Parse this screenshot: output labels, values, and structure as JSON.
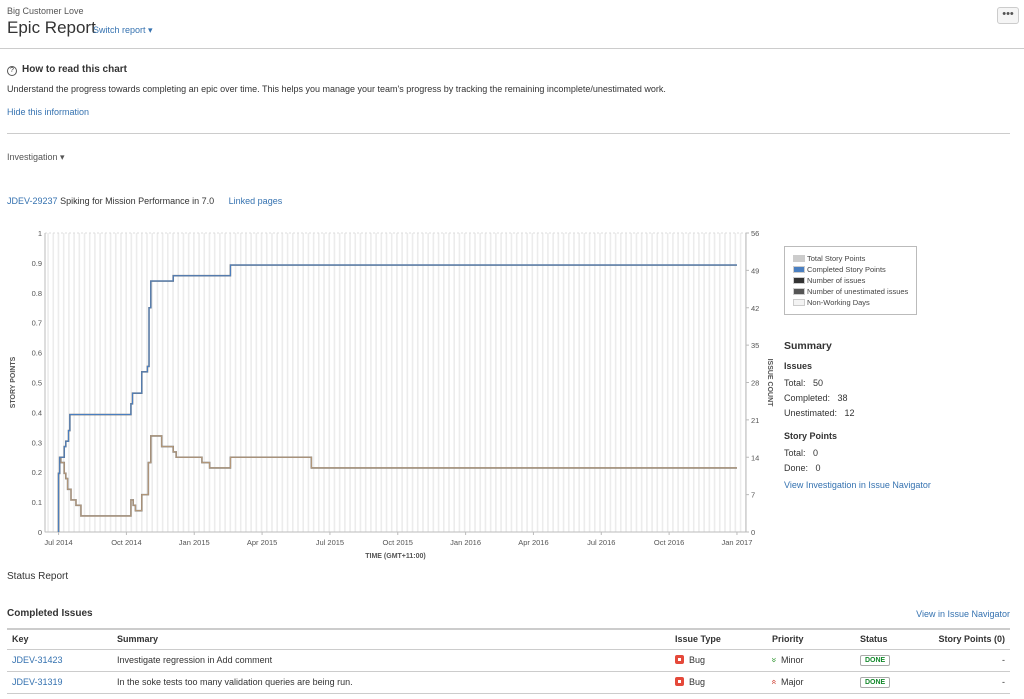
{
  "header": {
    "project": "Big Customer Love",
    "title": "Epic Report",
    "switch_report": "Switch report ▾",
    "more": "•••"
  },
  "howto": {
    "title": "How to read this chart",
    "description": "Understand the progress towards completing an epic over time. This helps you manage your team's progress by tracking the remaining incomplete/unestimated work.",
    "hide": "Hide this information"
  },
  "epic_select": "Investigation ▾",
  "epic": {
    "key": "JDEV-29237",
    "name": "Spiking for Mission Performance in 7.0",
    "linked": "Linked pages"
  },
  "colors": {
    "blue": "#4a7fc1",
    "brown": "#b89a7a",
    "dark": "#555555",
    "link": "#3572b0"
  },
  "chart_data": {
    "type": "line",
    "xlabel": "TIME (GMT+11:00)",
    "ylabel": "STORY POINTS",
    "y2label": "ISSUE COUNT",
    "x_unit": "months since Jul 2014",
    "xlim": [
      -0.6,
      30.4
    ],
    "x_ticks": [
      {
        "m": 0,
        "label": "Jul 2014"
      },
      {
        "m": 3,
        "label": "Oct 2014"
      },
      {
        "m": 6,
        "label": "Jan 2015"
      },
      {
        "m": 9,
        "label": "Apr 2015"
      },
      {
        "m": 12,
        "label": "Jul 2015"
      },
      {
        "m": 15,
        "label": "Oct 2015"
      },
      {
        "m": 18,
        "label": "Jan 2016"
      },
      {
        "m": 21,
        "label": "Apr 2016"
      },
      {
        "m": 24,
        "label": "Jul 2016"
      },
      {
        "m": 27,
        "label": "Oct 2016"
      },
      {
        "m": 30,
        "label": "Jan 2017"
      }
    ],
    "ylim": [
      0,
      1
    ],
    "y_ticks": [
      "0",
      "0.1",
      "0.2",
      "0.3",
      "0.4",
      "0.5",
      "0.6",
      "0.7",
      "0.8",
      "0.9",
      "1"
    ],
    "y2lim": [
      0,
      56
    ],
    "y2_ticks": [
      "0",
      "7",
      "14",
      "21",
      "28",
      "35",
      "42",
      "49",
      "56"
    ],
    "legend": [
      "Total Story Points",
      "Completed Story Points",
      "Number of issues",
      "Number of unestimated issues",
      "Non-Working Days"
    ],
    "series": [
      {
        "name": "Number of issues",
        "color": "#4a7fc1",
        "points": [
          [
            0,
            0
          ],
          [
            0,
            11
          ],
          [
            0.05,
            14
          ],
          [
            0.25,
            16
          ],
          [
            0.32,
            17
          ],
          [
            0.44,
            19
          ],
          [
            0.5,
            22
          ],
          [
            3.2,
            24
          ],
          [
            3.27,
            26
          ],
          [
            3.68,
            30
          ],
          [
            3.93,
            31
          ],
          [
            4.0,
            42
          ],
          [
            4.08,
            47
          ],
          [
            5.07,
            48
          ],
          [
            7.6,
            50
          ],
          [
            30,
            50
          ]
        ]
      },
      {
        "name": "Number of unestimated issues",
        "color": "#b89a7a",
        "points": [
          [
            0,
            0
          ],
          [
            0,
            11
          ],
          [
            0.05,
            14
          ],
          [
            0.1,
            13
          ],
          [
            0.25,
            11
          ],
          [
            0.32,
            10
          ],
          [
            0.4,
            8
          ],
          [
            0.55,
            6
          ],
          [
            0.77,
            5
          ],
          [
            0.99,
            3
          ],
          [
            3.2,
            6
          ],
          [
            3.3,
            5
          ],
          [
            3.4,
            4
          ],
          [
            3.68,
            7
          ],
          [
            3.97,
            13
          ],
          [
            4.08,
            18
          ],
          [
            4.56,
            16
          ],
          [
            5.07,
            15
          ],
          [
            5.2,
            14
          ],
          [
            6.34,
            13
          ],
          [
            6.68,
            12
          ],
          [
            7.6,
            14
          ],
          [
            11.18,
            12
          ],
          [
            30,
            12
          ]
        ]
      }
    ]
  },
  "summary": {
    "title": "Summary",
    "issues_title": "Issues",
    "total_label": "Total:",
    "total": "50",
    "completed_label": "Completed:",
    "completed": "38",
    "unestimated_label": "Unestimated:",
    "unestimated": "12",
    "sp_title": "Story Points",
    "sp_total_label": "Total:",
    "sp_total": "0",
    "sp_done_label": "Done:",
    "sp_done": "0",
    "navigator": "View Investigation in Issue Navigator"
  },
  "status_report": "Status Report",
  "completed": {
    "title": "Completed Issues",
    "navigator": "View in Issue Navigator",
    "columns": [
      "Key",
      "Summary",
      "Issue Type",
      "Priority",
      "Status",
      "Story Points (0)"
    ],
    "rows": [
      {
        "key": "JDEV-31423",
        "summary": "Investigate regression in Add comment",
        "type": "Bug",
        "priority": "Minor",
        "priority_icon": "»",
        "status": "DONE",
        "points": "-"
      },
      {
        "key": "JDEV-31319",
        "summary": "In the soke tests too many validation queries are being run.",
        "type": "Bug",
        "priority": "Major",
        "priority_icon": "«",
        "status": "DONE",
        "points": "-"
      }
    ]
  }
}
